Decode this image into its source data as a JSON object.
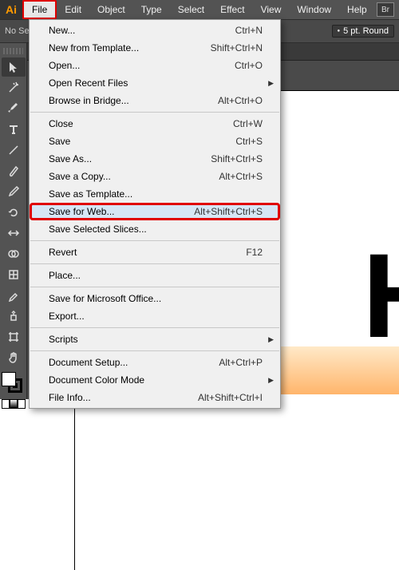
{
  "app_logo": "Ai",
  "menubar": [
    "File",
    "Edit",
    "Object",
    "Type",
    "Select",
    "Effect",
    "View",
    "Window",
    "Help"
  ],
  "br_badge": "Br",
  "optionsbar": {
    "nosel": "No Se",
    "stroke_label": "5 pt. Round"
  },
  "artboard_text": "Ho",
  "file_menu": {
    "groups": [
      [
        {
          "label": "New...",
          "shortcut": "Ctrl+N"
        },
        {
          "label": "New from Template...",
          "shortcut": "Shift+Ctrl+N"
        },
        {
          "label": "Open...",
          "shortcut": "Ctrl+O"
        },
        {
          "label": "Open Recent Files",
          "submenu": true
        },
        {
          "label": "Browse in Bridge...",
          "shortcut": "Alt+Ctrl+O"
        }
      ],
      [
        {
          "label": "Close",
          "shortcut": "Ctrl+W"
        },
        {
          "label": "Save",
          "shortcut": "Ctrl+S"
        },
        {
          "label": "Save As...",
          "shortcut": "Shift+Ctrl+S"
        },
        {
          "label": "Save a Copy...",
          "shortcut": "Alt+Ctrl+S"
        },
        {
          "label": "Save as Template..."
        },
        {
          "label": "Save for Web...",
          "shortcut": "Alt+Shift+Ctrl+S",
          "highlight": "red"
        },
        {
          "label": "Save Selected Slices..."
        }
      ],
      [
        {
          "label": "Revert",
          "shortcut": "F12"
        }
      ],
      [
        {
          "label": "Place..."
        }
      ],
      [
        {
          "label": "Save for Microsoft Office..."
        },
        {
          "label": "Export..."
        }
      ],
      [
        {
          "label": "Scripts",
          "submenu": true
        }
      ],
      [
        {
          "label": "Document Setup...",
          "shortcut": "Alt+Ctrl+P"
        },
        {
          "label": "Document Color Mode",
          "submenu": true
        },
        {
          "label": "File Info...",
          "shortcut": "Alt+Shift+Ctrl+I"
        }
      ]
    ]
  }
}
